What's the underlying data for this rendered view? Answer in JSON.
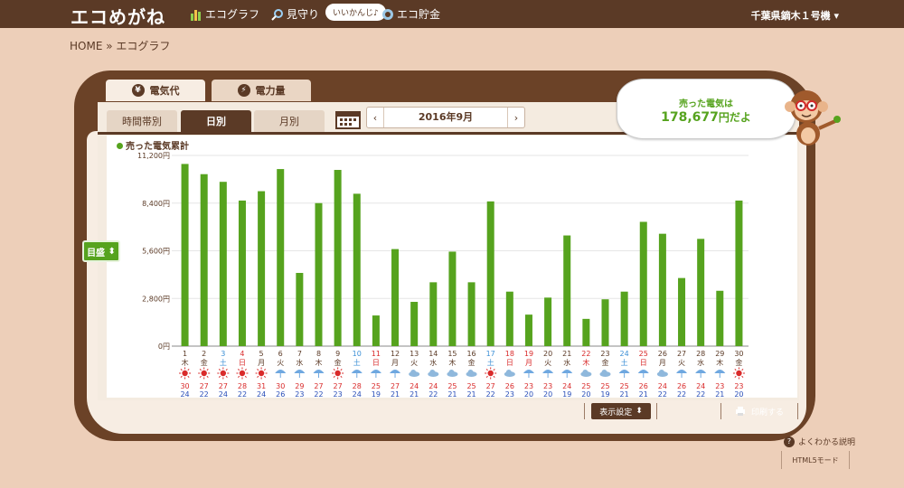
{
  "header": {
    "logo": "エコめがね",
    "nav": [
      {
        "label": "エコグラフ",
        "icon": "bar-graph-icon"
      },
      {
        "label": "見守り",
        "icon": "magnifier-icon"
      },
      {
        "label": "エコ貯金",
        "icon": "coin-icon"
      }
    ],
    "bubble": "いいかんじ♪",
    "user": "千葉県鏑木１号機"
  },
  "breadcrumb": "HOME » エコグラフ",
  "top_tabs": [
    {
      "label": "電気代",
      "icon": "yen-icon",
      "active": true
    },
    {
      "label": "電力量",
      "icon": "lightning-icon",
      "active": false
    }
  ],
  "sub_tabs": [
    {
      "label": "時間帯別",
      "active": false
    },
    {
      "label": "日別",
      "active": true
    },
    {
      "label": "月別",
      "active": false
    }
  ],
  "month_nav": {
    "prev": "‹",
    "label": "2016年9月",
    "next": "›"
  },
  "scale_button": "目盛",
  "speech": {
    "line1": "売った電気は",
    "amount": "178,677",
    "suffix": "円だよ"
  },
  "footer": {
    "display_settings": "表示設定",
    "print": "印刷する",
    "help": "よくわかる説明",
    "html5": "HTML5モード"
  },
  "colors": {
    "bar": "#56a31e",
    "brown": "#5b3a26",
    "saturday": "#3b8fd6",
    "sunday": "#d92b2b",
    "high": "#d92b2b",
    "low": "#2a4fb8"
  },
  "chart_data": {
    "type": "bar",
    "title": "売った電気累計",
    "ylim": [
      0,
      11200
    ],
    "yticks": [
      "0円",
      "2,800円",
      "5,600円",
      "8,400円",
      "11,200円"
    ],
    "categories": [
      "1",
      "2",
      "3",
      "4",
      "5",
      "6",
      "7",
      "8",
      "9",
      "10",
      "11",
      "12",
      "13",
      "14",
      "15",
      "16",
      "17",
      "18",
      "19",
      "20",
      "21",
      "22",
      "23",
      "24",
      "25",
      "26",
      "27",
      "28",
      "29",
      "30"
    ],
    "weekdays": [
      "木",
      "金",
      "土",
      "日",
      "月",
      "火",
      "水",
      "木",
      "金",
      "土",
      "日",
      "月",
      "火",
      "水",
      "木",
      "金",
      "土",
      "日",
      "月",
      "火",
      "水",
      "木",
      "金",
      "土",
      "日",
      "月",
      "火",
      "水",
      "木",
      "金"
    ],
    "day_colors": [
      "n",
      "n",
      "sat",
      "sun",
      "n",
      "n",
      "n",
      "n",
      "n",
      "sat",
      "sun",
      "n",
      "n",
      "n",
      "n",
      "n",
      "sat",
      "sun",
      "sun",
      "n",
      "n",
      "sun",
      "n",
      "sat",
      "sun",
      "n",
      "n",
      "n",
      "n",
      "n"
    ],
    "weather": [
      "sunny",
      "sunny",
      "sunny",
      "sunny",
      "sunny",
      "umbrella",
      "umbrella",
      "umbrella",
      "sunny",
      "umbrella",
      "umbrella",
      "umbrella",
      "cloudy",
      "cloudy",
      "cloudy",
      "cloudy",
      "sunny",
      "cloudy",
      "umbrella",
      "umbrella",
      "umbrella",
      "cloudy",
      "cloudy",
      "umbrella",
      "umbrella",
      "cloudy",
      "umbrella",
      "umbrella",
      "umbrella",
      "sunny"
    ],
    "high_temps": [
      "30",
      "27",
      "27",
      "28",
      "31",
      "30",
      "29",
      "27",
      "27",
      "28",
      "25",
      "27",
      "24",
      "24",
      "25",
      "25",
      "27",
      "26",
      "23",
      "23",
      "24",
      "25",
      "25",
      "25",
      "26",
      "24",
      "26",
      "24",
      "23",
      "23"
    ],
    "low_temps": [
      "24",
      "22",
      "24",
      "22",
      "24",
      "26",
      "23",
      "22",
      "23",
      "24",
      "19",
      "21",
      "21",
      "22",
      "21",
      "21",
      "22",
      "23",
      "20",
      "20",
      "19",
      "20",
      "19",
      "21",
      "21",
      "22",
      "22",
      "22",
      "21",
      "20"
    ],
    "values": [
      10700,
      10100,
      9650,
      8550,
      9100,
      10400,
      4300,
      8400,
      10350,
      8950,
      1800,
      5700,
      2600,
      3750,
      5550,
      3750,
      8500,
      3200,
      1850,
      2850,
      6500,
      1600,
      2750,
      3200,
      7300,
      6600,
      4000,
      6300,
      3250,
      8550
    ]
  }
}
